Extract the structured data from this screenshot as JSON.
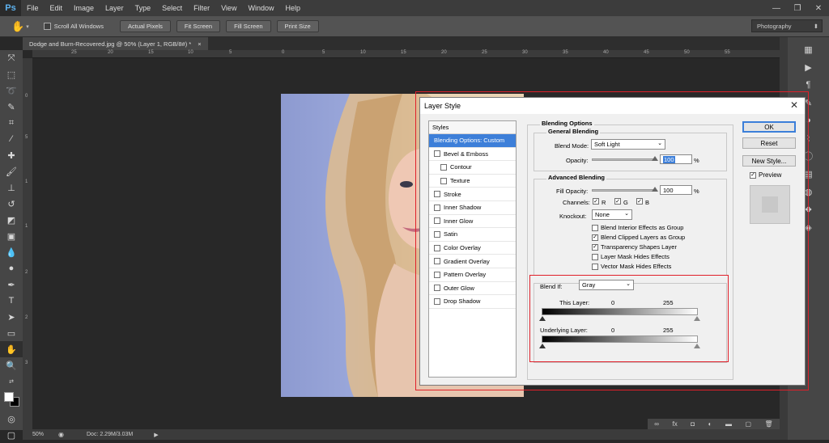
{
  "app": {
    "logo": "Ps"
  },
  "menu": [
    "File",
    "Edit",
    "Image",
    "Layer",
    "Type",
    "Select",
    "Filter",
    "View",
    "Window",
    "Help"
  ],
  "window_controls": {
    "minimize": "—",
    "restore": "❐",
    "close": "✕"
  },
  "options_bar": {
    "scroll_all_windows": "Scroll All Windows",
    "actual_pixels": "Actual Pixels",
    "fit_screen": "Fit Screen",
    "fill_screen": "Fill Screen",
    "print_size": "Print Size",
    "workspace": "Photography"
  },
  "document_tab": {
    "title": "Dodge and Burn-Recovered.jpg @ 50% (Layer 1, RGB/8#) *",
    "close": "×"
  },
  "ruler": {
    "top_ticks": [
      "25",
      "20",
      "15",
      "10",
      "5",
      "0",
      "5",
      "10",
      "15",
      "20",
      "25",
      "30",
      "35",
      "40",
      "45",
      "50",
      "55"
    ],
    "left_ticks": [
      "0",
      "5",
      "1",
      "1",
      "2",
      "2",
      "3"
    ]
  },
  "status_bar": {
    "zoom": "50%",
    "doc": "Doc: 2.29M/3.03M"
  },
  "dialog": {
    "title": "Layer Style",
    "close": "✕",
    "styles_header": "Styles",
    "styles": [
      {
        "label": "Blending Options: Custom",
        "selected": true,
        "checkbox": false,
        "indent": false
      },
      {
        "label": "Bevel & Emboss",
        "selected": false,
        "checkbox": true,
        "indent": false
      },
      {
        "label": "Contour",
        "selected": false,
        "checkbox": true,
        "indent": true
      },
      {
        "label": "Texture",
        "selected": false,
        "checkbox": true,
        "indent": true
      },
      {
        "label": "Stroke",
        "selected": false,
        "checkbox": true,
        "indent": false
      },
      {
        "label": "Inner Shadow",
        "selected": false,
        "checkbox": true,
        "indent": false
      },
      {
        "label": "Inner Glow",
        "selected": false,
        "checkbox": true,
        "indent": false
      },
      {
        "label": "Satin",
        "selected": false,
        "checkbox": true,
        "indent": false
      },
      {
        "label": "Color Overlay",
        "selected": false,
        "checkbox": true,
        "indent": false
      },
      {
        "label": "Gradient Overlay",
        "selected": false,
        "checkbox": true,
        "indent": false
      },
      {
        "label": "Pattern Overlay",
        "selected": false,
        "checkbox": true,
        "indent": false
      },
      {
        "label": "Outer Glow",
        "selected": false,
        "checkbox": true,
        "indent": false
      },
      {
        "label": "Drop Shadow",
        "selected": false,
        "checkbox": true,
        "indent": false
      }
    ],
    "blending_options_title": "Blending Options",
    "general_blending_title": "General Blending",
    "blend_mode_label": "Blend Mode:",
    "blend_mode_value": "Soft Light",
    "opacity_label": "Opacity:",
    "opacity_value": "100",
    "percent": "%",
    "advanced_blending_title": "Advanced Blending",
    "fill_opacity_label": "Fill Opacity:",
    "fill_opacity_value": "100",
    "channels_label": "Channels:",
    "channel_r": "R",
    "channel_g": "G",
    "channel_b": "B",
    "knockout_label": "Knockout:",
    "knockout_value": "None",
    "adv_checks": [
      {
        "label": "Blend Interior Effects as Group",
        "checked": false
      },
      {
        "label": "Blend Clipped Layers as Group",
        "checked": true
      },
      {
        "label": "Transparency Shapes Layer",
        "checked": true
      },
      {
        "label": "Layer Mask Hides Effects",
        "checked": false
      },
      {
        "label": "Vector Mask Hides Effects",
        "checked": false
      }
    ],
    "blend_if_label": "Blend If:",
    "blend_if_value": "Gray",
    "this_layer_label": "This Layer:",
    "this_layer_min": "0",
    "this_layer_max": "255",
    "underlying_layer_label": "Underlying Layer:",
    "underlying_layer_min": "0",
    "underlying_layer_max": "255",
    "ok": "OK",
    "reset": "Reset",
    "new_style": "New Style...",
    "preview": "Preview"
  },
  "colors": {
    "accent": "#3d7fd9",
    "highlight": "#e0202a",
    "ps_blue": "#5eb3f0"
  }
}
